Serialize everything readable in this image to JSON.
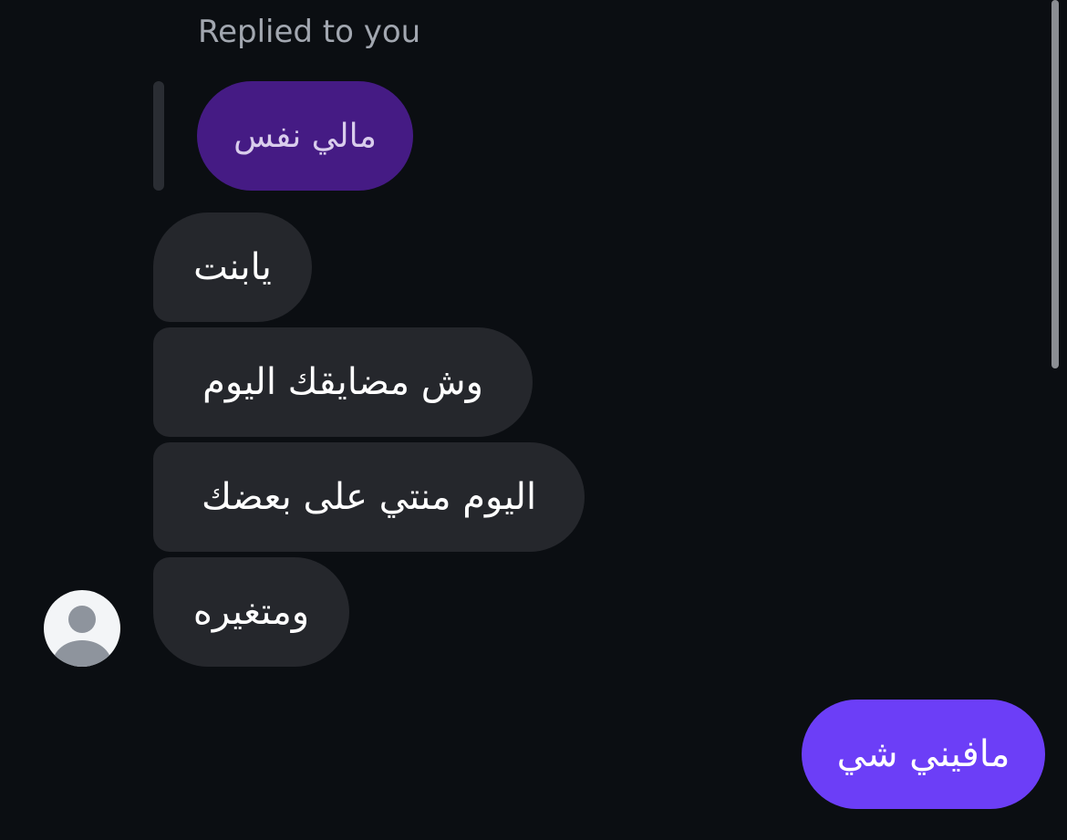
{
  "reply": {
    "header": "Replied to you",
    "quoted_message": "مالي نفس"
  },
  "incoming_messages": [
    "يابنت",
    "وش مضايقك اليوم",
    "اليوم منتي على بعضك",
    "ومتغيره"
  ],
  "outgoing_messages": [
    "مافيني شي"
  ],
  "icons": {
    "avatar": "default-user-avatar-icon"
  },
  "colors": {
    "background": "#0b0e12",
    "incoming_bubble": "#25272c",
    "quoted_bubble": "#451b84",
    "outgoing_bubble": "#6c3ef7"
  }
}
